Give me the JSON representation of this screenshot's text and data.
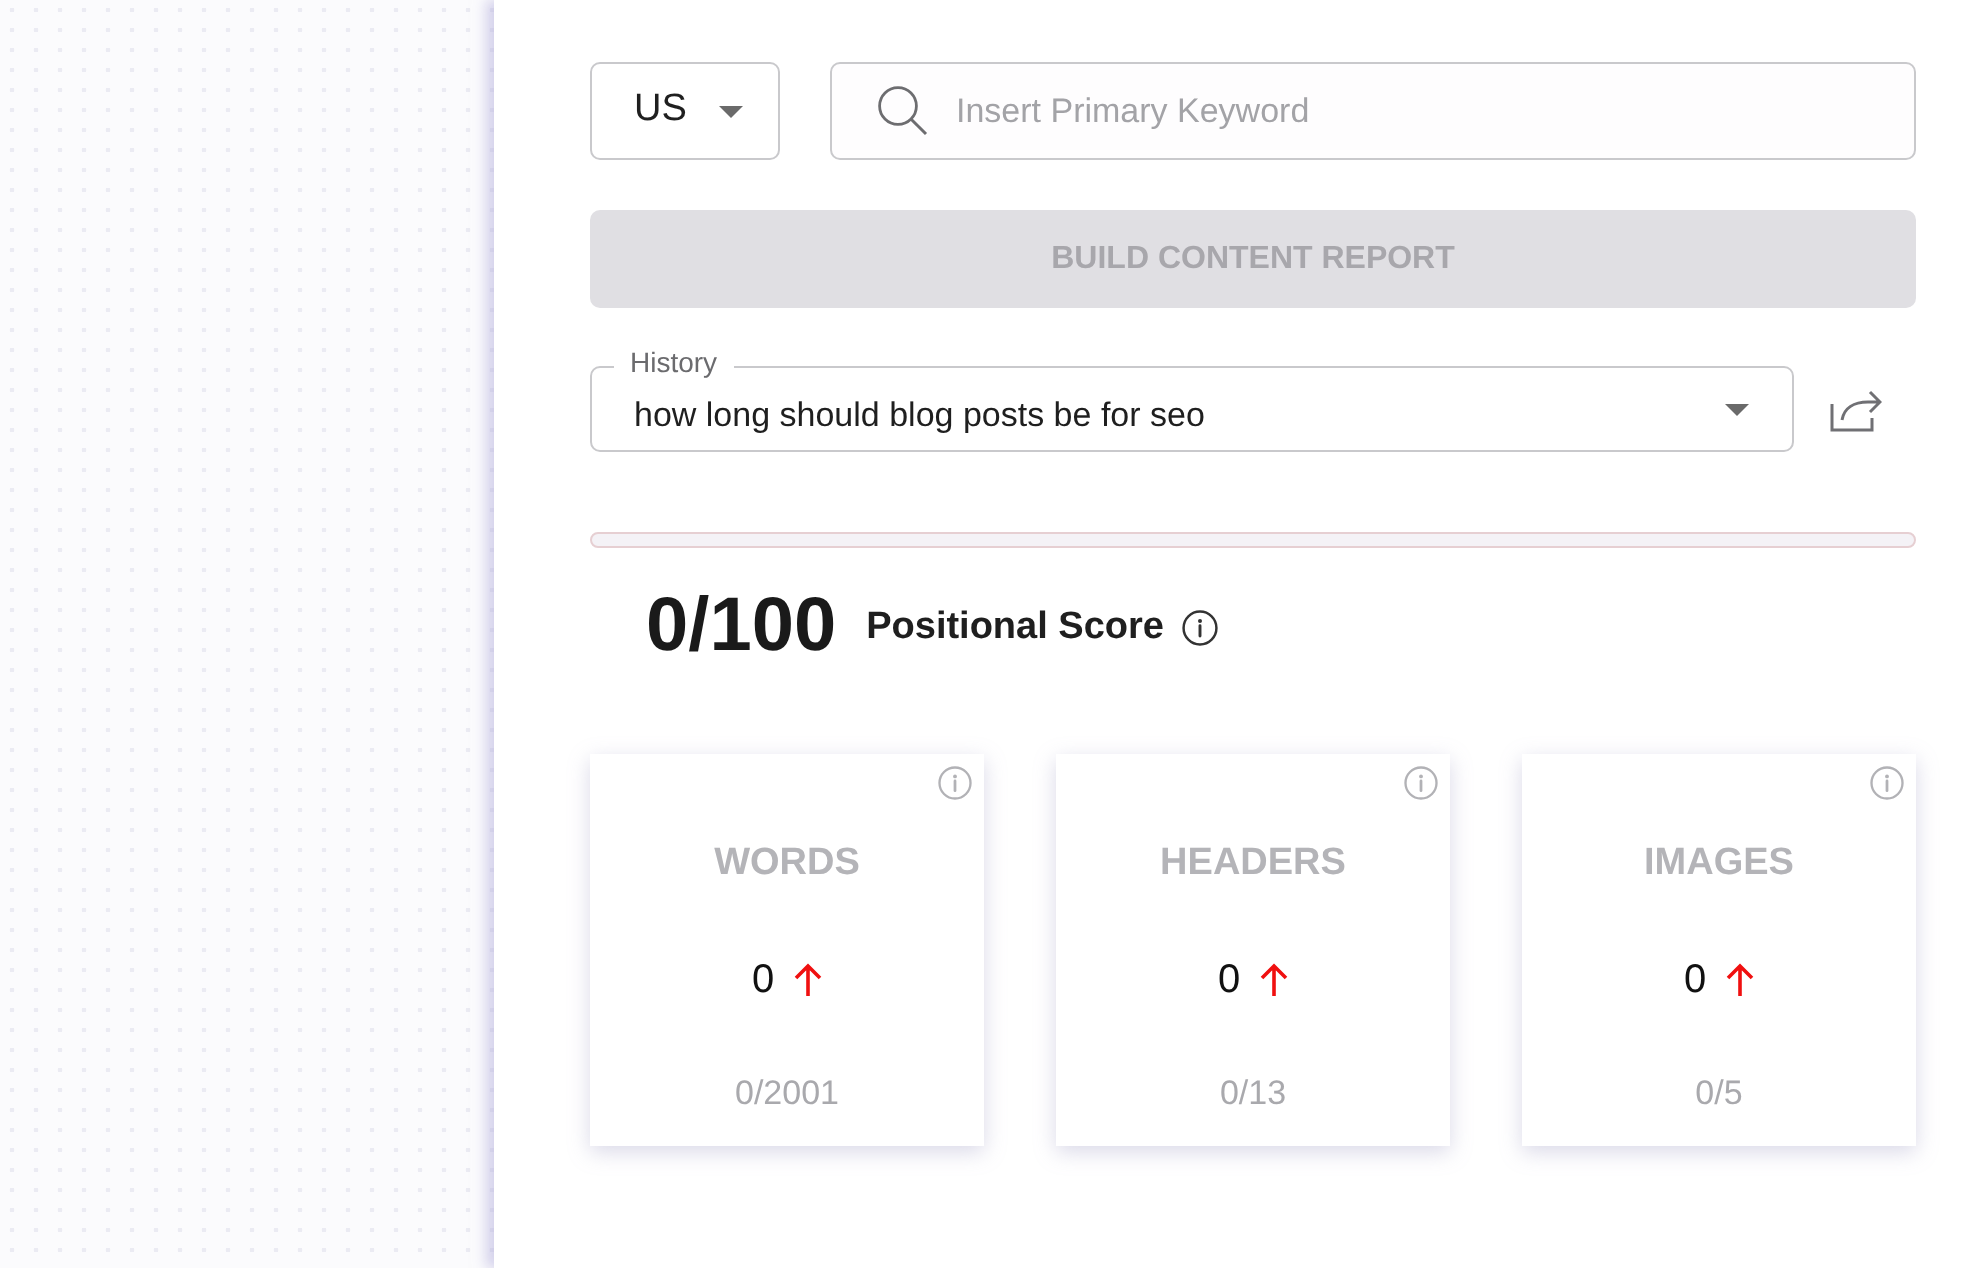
{
  "country_select": {
    "value": "US"
  },
  "keyword_field": {
    "placeholder": "Insert Primary Keyword"
  },
  "build_button": {
    "label": "BUILD CONTENT REPORT",
    "disabled": true
  },
  "history_select": {
    "label": "History",
    "value": "how long should blog posts be for seo"
  },
  "progress": {
    "level": 0
  },
  "score": {
    "value": "0/100",
    "label": "Positional Score"
  },
  "metric_cards": [
    {
      "title": "WORDS",
      "value": "0",
      "trend_up": true,
      "target": "0/2001"
    },
    {
      "title": "HEADERS",
      "value": "0",
      "trend_up": true,
      "target": "0/13"
    },
    {
      "title": "IMAGES",
      "value": "0",
      "trend_up": true,
      "target": "0/5"
    }
  ]
}
